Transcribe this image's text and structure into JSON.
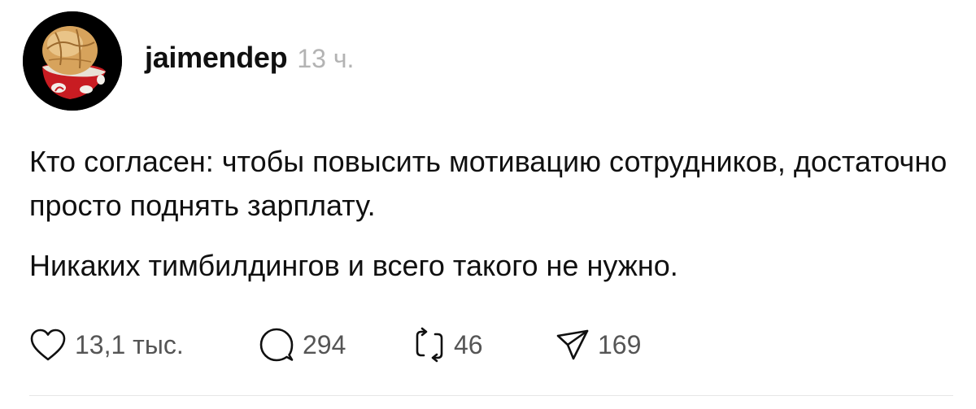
{
  "post": {
    "username": "jaimendep",
    "time": "13 ч.",
    "paragraphs": [
      "Кто согласен: чтобы повысить мотивацию сотрудников, достаточно просто поднять зарплату.",
      "Никаких тимбилдингов и всего такого не нужно."
    ],
    "avatar_icon": "bun-in-bowl-avatar"
  },
  "actions": {
    "likes": "13,1 тыс.",
    "replies": "294",
    "reposts": "46",
    "shares": "169",
    "icons": [
      "heart-icon",
      "comment-icon",
      "repost-icon",
      "share-icon"
    ]
  },
  "colors": {
    "text": "#101010",
    "muted": "#b3b3b3",
    "counts": "#555555",
    "divider": "#e6e6e6"
  }
}
